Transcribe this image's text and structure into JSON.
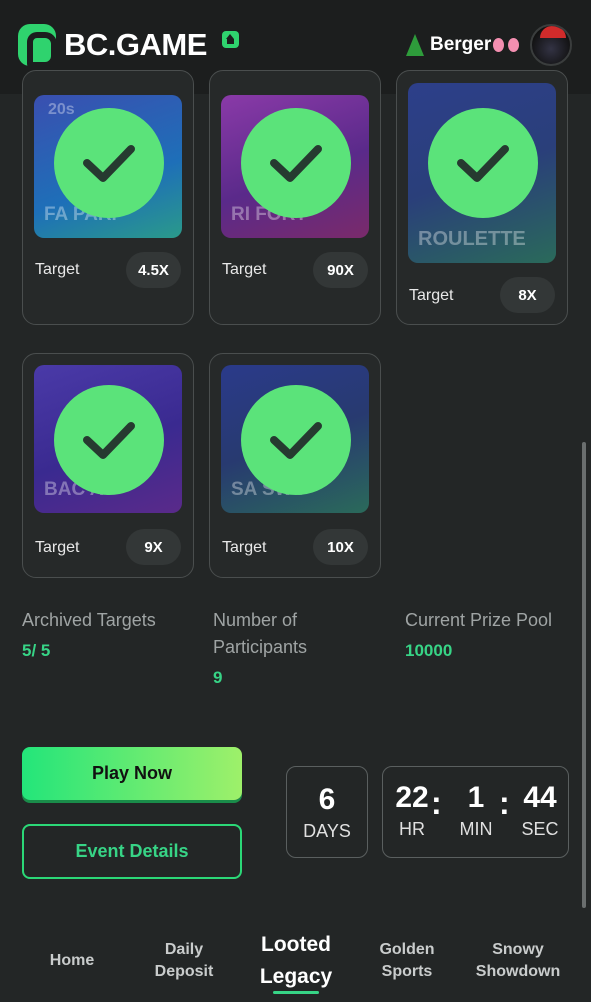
{
  "header": {
    "logo_text": "BC.GAME",
    "username": "Berger",
    "icons": [
      "bc-logo-icon",
      "home-icon",
      "christmas-tree-icon",
      "bow-icon",
      "avatar"
    ]
  },
  "cards": [
    {
      "game": "FAST PARITY",
      "target_label": "Target",
      "target_value": "4.5X",
      "completed": true
    },
    {
      "game": "RING OF FORTUNE",
      "target_label": "Target",
      "target_value": "90X",
      "completed": true
    },
    {
      "game": "ROULETTE",
      "target_label": "Target",
      "target_value": "8X",
      "completed": true
    },
    {
      "game": "BACCARAT",
      "target_label": "Target",
      "target_value": "9X",
      "completed": true
    },
    {
      "game": "SABER SWORD",
      "target_label": "Target",
      "target_value": "10X",
      "completed": true
    }
  ],
  "card_thumb_texts": {
    "c0": "FA   PARI",
    "c0_badge": "20s",
    "c1": "RI   FORT",
    "c2": "ROULETTE",
    "c3": "BAC    AT",
    "c4": "SA   SWO"
  },
  "stats": {
    "archived_label": "Archived Targets",
    "archived_value": "5/ 5",
    "participants_label_1": "Number of",
    "participants_label_2": "Participants",
    "participants_value": "9",
    "prize_label": "Current Prize Pool",
    "prize_value": "10000"
  },
  "buttons": {
    "play": "Play Now",
    "details": "Event Details"
  },
  "countdown": {
    "days": "6",
    "days_unit": "DAYS",
    "hours": "22",
    "hours_unit": "HR",
    "minutes": "1",
    "minutes_unit": "MIN",
    "seconds": "44",
    "seconds_unit": "SEC"
  },
  "tabs": [
    {
      "line1": "Home",
      "line2": ""
    },
    {
      "line1": "Daily",
      "line2": "Deposit"
    },
    {
      "line1": "Looted",
      "line2": "Legacy"
    },
    {
      "line1": "Golden",
      "line2": "Sports"
    },
    {
      "line1": "Snowy",
      "line2": "Showdown"
    }
  ],
  "active_tab": "Looted Legacy",
  "colors": {
    "accent": "#37d486",
    "check": "#5be37a",
    "background": "#232626"
  }
}
